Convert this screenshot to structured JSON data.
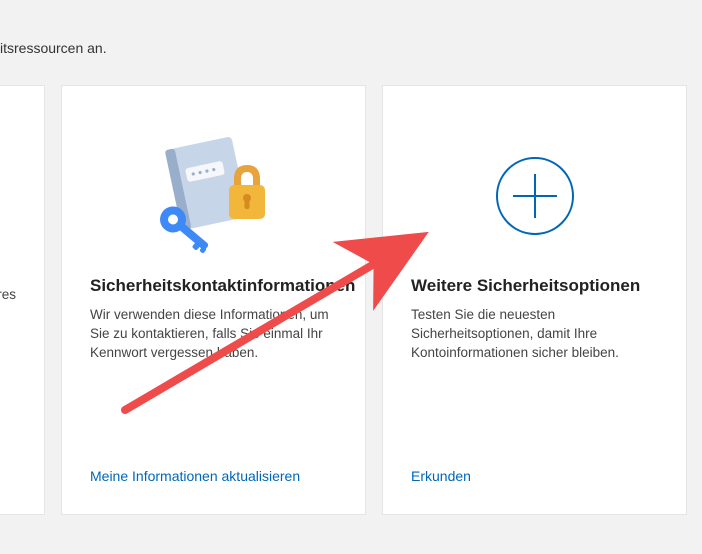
{
  "header": {
    "fragment": "itsressourcen an."
  },
  "cards": {
    "partial": {
      "desc_fragment": "keres"
    },
    "security_contact": {
      "title": "Sicherheitskontaktinformationen",
      "desc": "Wir verwenden diese Informationen, um Sie zu kontaktieren, falls Sie einmal Ihr Kennwort vergessen haben.",
      "link": "Meine Informationen aktualisieren"
    },
    "more_options": {
      "title": "Weitere Sicherheitsoptionen",
      "desc": "Testen Sie die neuesten Sicherheitsoptionen, damit Ihre Kontoinformationen sicher bleiben.",
      "link": "Erkunden"
    }
  }
}
